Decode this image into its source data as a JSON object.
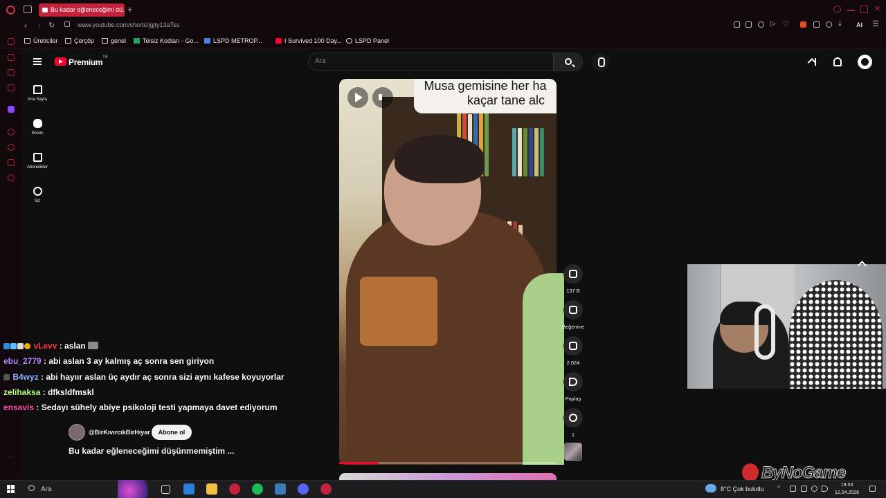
{
  "browser": {
    "active_tab_title": "Bu kadar eğleneceğimi dü...",
    "new_tab_glyph": "+",
    "url": "www.youtube.com/shorts/jgjty13aTss",
    "ai_label": "AI",
    "bookmarks": [
      {
        "label": "Üreticiler",
        "icon": "folder-icon"
      },
      {
        "label": "Çerçöp",
        "icon": "folder-icon"
      },
      {
        "label": "genel",
        "icon": "folder-icon"
      },
      {
        "label": "Telsiz Kodları - Go...",
        "icon": "sheets-icon"
      },
      {
        "label": "LSPD METROP...",
        "icon": "docs-icon"
      },
      {
        "label": "I Survived 100 Day...",
        "icon": "youtube-icon"
      },
      {
        "label": "LSPD Panel",
        "icon": "globe-icon"
      }
    ]
  },
  "youtube": {
    "brand": "Premium",
    "region": "TR",
    "search_placeholder": "Ara",
    "guide": [
      {
        "label": "Ana Sayfa",
        "icon": "home-icon"
      },
      {
        "label": "Shorts",
        "icon": "shorts-icon"
      },
      {
        "label": "Abonelikler",
        "icon": "subscriptions-icon"
      },
      {
        "label": "Siz",
        "icon": "you-icon"
      }
    ],
    "short": {
      "caption_line1": "Musa gemisine her ha",
      "caption_line2": "kaçar tane alc",
      "progress_fraction": 0.18,
      "channel": "@BirKıvırcıkBirHıyar",
      "subscribe_label": "Abone ol",
      "title": "Bu kadar eğleneceğimi düşünmemiştim ..."
    },
    "actions": {
      "like_count": "137 B",
      "dislike_label": "Beğenme",
      "comment_count": "2.024",
      "share_label": "Paylaş",
      "remix_count": "1"
    }
  },
  "chat": [
    {
      "user": "vLevv",
      "message": ": aslan",
      "color": "#ff4040"
    },
    {
      "user": "ebu_2779",
      "message": ": abi aslan 3 ay kalmış aç sonra sen giriyon",
      "color": "#b784ff"
    },
    {
      "user": "B4wyz",
      "message": ": abi hayıır aslan üç aydır aç sonra sizi aynı kafese koyuyorlar",
      "color": "#8fb6ff"
    },
    {
      "user": "zelihaksa",
      "message": ": dfksldfmskl",
      "color": "#b6ff7a"
    },
    {
      "user": "ensavis",
      "message": ": Sedayı sühely abiye psikoloji testi yapmaya davet ediyorum",
      "color": "#ff4fa8"
    }
  ],
  "stream": {
    "watermark": "ByNoGame"
  },
  "taskbar": {
    "search_label": "Ara",
    "weather": "8°C  Çok bulutlu",
    "time": "19:53",
    "date": "12.04.2026"
  }
}
